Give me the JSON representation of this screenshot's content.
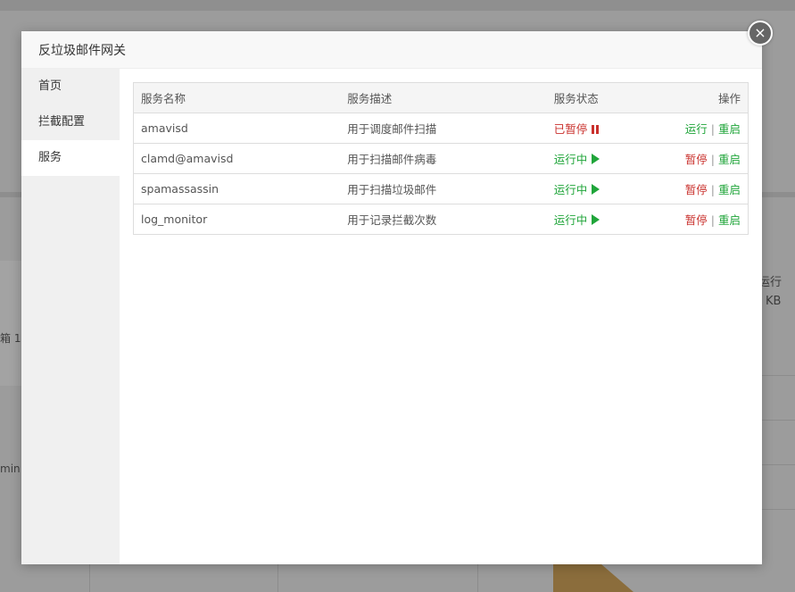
{
  "modal": {
    "title": "反垃圾邮件网关",
    "close_symbol": "×"
  },
  "sidebar": {
    "items": [
      {
        "label": "首页",
        "active": false
      },
      {
        "label": "拦截配置",
        "active": false
      },
      {
        "label": "服务",
        "active": true
      }
    ]
  },
  "services": {
    "headers": [
      "服务名称",
      "服务描述",
      "服务状态",
      "操作"
    ],
    "rows": [
      {
        "name": "amavisd",
        "desc": "用于调度邮件扫描",
        "status": "已暂停",
        "state": "stopped",
        "primary_action": "运行",
        "secondary_action": "重启"
      },
      {
        "name": "clamd@amavisd",
        "desc": "用于扫描邮件病毒",
        "status": "运行中",
        "state": "running",
        "primary_action": "暂停",
        "secondary_action": "重启"
      },
      {
        "name": "spamassassin",
        "desc": "用于扫描垃圾邮件",
        "status": "运行中",
        "state": "running",
        "primary_action": "暂停",
        "secondary_action": "重启"
      },
      {
        "name": "log_monitor",
        "desc": "用于记录拦截次数",
        "status": "运行中",
        "state": "running",
        "primary_action": "暂停",
        "secondary_action": "重启"
      }
    ],
    "separator": "|"
  },
  "background": {
    "right_text_1": "运行",
    "right_text_2": "KB",
    "left_text_1": "箱 1",
    "left_text_2": "min"
  },
  "colors": {
    "green": "#20a53a",
    "red": "#c9302c"
  }
}
